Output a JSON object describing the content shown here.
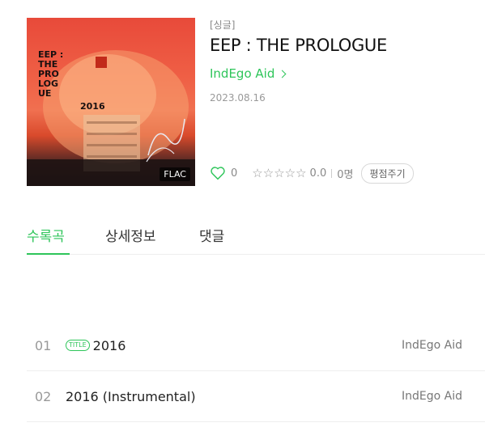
{
  "album": {
    "type_label": "[싱글]",
    "title": "EEP : THE PROLOGUE",
    "artist": "IndEgo Aid",
    "release_date": "2023.08.16",
    "cover": {
      "title_text": "EEP : THE PRO LOG UE",
      "year_text": "2016",
      "format_badge": "FLAC"
    }
  },
  "stats": {
    "likes": "0",
    "score": "0.0",
    "raters": "0명",
    "rate_button": "평점주기",
    "star_icons": [
      "star-empty-icon",
      "star-empty-icon",
      "star-empty-icon",
      "star-empty-icon",
      "star-empty-icon"
    ]
  },
  "tabs": [
    {
      "label": "수록곡",
      "active": true
    },
    {
      "label": "상세정보",
      "active": false
    },
    {
      "label": "댓글",
      "active": false
    }
  ],
  "tracks": [
    {
      "number": "01",
      "badge": "TITLE",
      "title": "2016",
      "artist": "IndEgo Aid"
    },
    {
      "number": "02",
      "badge": "",
      "title": "2016 (Instrumental)",
      "artist": "IndEgo Aid"
    }
  ],
  "colors": {
    "accent": "#2ec55a",
    "muted": "#999999"
  }
}
